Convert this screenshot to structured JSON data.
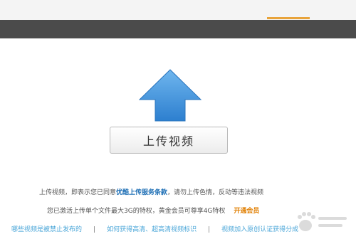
{
  "upload": {
    "button_label": "上传视频"
  },
  "notice": {
    "line1_prefix": "上传视频，即表示您已同意",
    "terms_link": "优酷上传服务条款",
    "line1_suffix": "，请勿上传色情，反动等违法视频",
    "line2_text": "您已激活上传单个文件最大3G的特权，黄金会员可尊享4G特权",
    "member_link": "开通会员"
  },
  "faq": {
    "links": [
      "哪些视频是被禁止发布的",
      "如何获得高清、超高清视频标识",
      "视频加入原创认证获得分成"
    ],
    "separator": "|"
  },
  "colors": {
    "header_bar": "#4b4b4b",
    "upload_icon": "#3f8fd6",
    "terms_link": "#1e6fb5",
    "member_link": "#e07e00",
    "faq_link": "#4aa6d8"
  },
  "icons": {
    "upload": "upload-arrow-icon",
    "watermark": "paw-watermark-icon"
  }
}
